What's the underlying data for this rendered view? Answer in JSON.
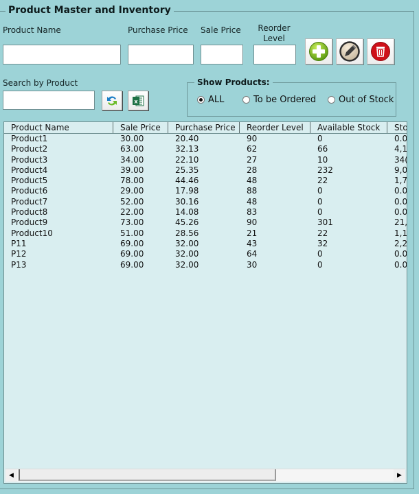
{
  "window": {
    "title": "Product Master and Inventory"
  },
  "form": {
    "product_name_label": "Product Name",
    "purchase_price_label": "Purchase Price",
    "sale_price_label": "Sale Price",
    "reorder_level_label_line1": "Reorder",
    "reorder_level_label_line2": "Level",
    "product_name_value": "",
    "purchase_price_value": "",
    "sale_price_value": "",
    "reorder_level_value": ""
  },
  "buttons": {
    "add": {
      "icon": "plus-circle-icon",
      "color": "#7cc21d"
    },
    "edit": {
      "icon": "pencil-icon",
      "color": "#3c3c3c"
    },
    "delete": {
      "icon": "trash-icon",
      "color": "#d0121b"
    },
    "refresh": {
      "icon": "refresh-arrows-icon"
    },
    "export": {
      "icon": "excel-icon",
      "color": "#1e7145"
    }
  },
  "search": {
    "label": "Search by Product",
    "value": ""
  },
  "filter": {
    "title": "Show Products:",
    "options": [
      {
        "label": "ALL",
        "checked": true
      },
      {
        "label": "To be Ordered",
        "checked": false
      },
      {
        "label": "Out of Stock",
        "checked": false
      }
    ]
  },
  "table": {
    "columns": [
      "Product Name",
      "Sale Price",
      "Purchase Price",
      "Reorder Level",
      "Available Stock",
      "Sto"
    ],
    "rows": [
      [
        "Product1",
        "30.00",
        "20.40",
        "90",
        "0",
        "0.0"
      ],
      [
        "Product2",
        "63.00",
        "32.13",
        "62",
        "66",
        "4,1"
      ],
      [
        "Product3",
        "34.00",
        "22.10",
        "27",
        "10",
        "34("
      ],
      [
        "Product4",
        "39.00",
        "25.35",
        "28",
        "232",
        "9,0"
      ],
      [
        "Product5",
        "78.00",
        "44.46",
        "48",
        "22",
        "1,7"
      ],
      [
        "Product6",
        "29.00",
        "17.98",
        "88",
        "0",
        "0.0"
      ],
      [
        "Product7",
        "52.00",
        "30.16",
        "48",
        "0",
        "0.0"
      ],
      [
        "Product8",
        "22.00",
        "14.08",
        "83",
        "0",
        "0.0"
      ],
      [
        "Product9",
        "73.00",
        "45.26",
        "90",
        "301",
        "21,"
      ],
      [
        "Product10",
        "51.00",
        "28.56",
        "21",
        "22",
        "1,1"
      ],
      [
        "P11",
        "69.00",
        "32.00",
        "43",
        "32",
        "2,2"
      ],
      [
        "P12",
        "69.00",
        "32.00",
        "64",
        "0",
        "0.0"
      ],
      [
        "P13",
        "69.00",
        "32.00",
        "30",
        "0",
        "0.0"
      ]
    ]
  },
  "scrollbar": {
    "left_arrow": "◀",
    "right_arrow": "▶"
  }
}
